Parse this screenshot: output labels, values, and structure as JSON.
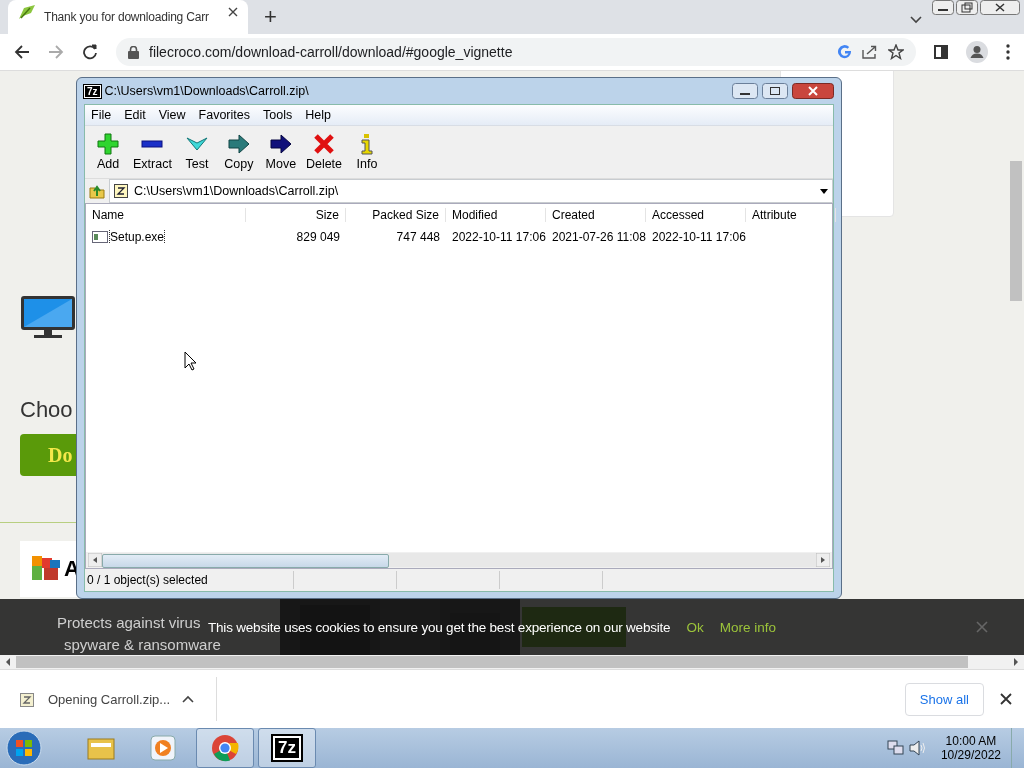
{
  "browser": {
    "tabs": [
      {
        "title": "Thank you for downloading Carr",
        "selected": true
      }
    ],
    "new_tab": "+",
    "url": "filecroco.com/download-carroll/download/#google_vignette"
  },
  "page": {
    "choose_text": "Choo",
    "download_button": "Do",
    "antivirus_name": "A",
    "antivirus_desc": "Protects against virus",
    "antivirus_desc2": "spyware & ransomware"
  },
  "archive_window": {
    "app_icon": "7z",
    "title": "C:\\Users\\vm1\\Downloads\\Carroll.zip\\",
    "menu": [
      "File",
      "Edit",
      "View",
      "Favorites",
      "Tools",
      "Help"
    ],
    "toolbar": [
      {
        "label": "Add",
        "kind": "add"
      },
      {
        "label": "Extract",
        "kind": "extract"
      },
      {
        "label": "Test",
        "kind": "test"
      },
      {
        "label": "Copy",
        "kind": "copy"
      },
      {
        "label": "Move",
        "kind": "move"
      },
      {
        "label": "Delete",
        "kind": "delete"
      },
      {
        "label": "Info",
        "kind": "info"
      }
    ],
    "path": "C:\\Users\\vm1\\Downloads\\Carroll.zip\\",
    "columns": [
      {
        "label": "Name"
      },
      {
        "label": "Size"
      },
      {
        "label": "Packed Size"
      },
      {
        "label": "Modified"
      },
      {
        "label": "Created"
      },
      {
        "label": "Accessed"
      },
      {
        "label": "Attribute"
      }
    ],
    "rows": [
      {
        "cells": [
          "Setup.exe",
          "829 049",
          "747 448",
          "2022-10-11 17:06",
          "2021-07-26 11:08",
          "2022-10-11 17:06"
        ],
        "focused": true
      }
    ],
    "status": [
      "0 / 1 object(s) selected"
    ]
  },
  "cookie_bar": {
    "message": "This website uses cookies to ensure you get the best experience on our website",
    "ok": "Ok",
    "more": "More info"
  },
  "download_bar": {
    "items": [
      {
        "name": "Opening Carroll.zip..."
      }
    ],
    "show_all": "Show all"
  },
  "taskbar": {
    "apps": [
      {
        "kind": "explorer",
        "active": false
      },
      {
        "kind": "media",
        "active": false
      },
      {
        "kind": "chrome",
        "active": true
      },
      {
        "kind": "sevenzip",
        "label": "7z",
        "active": true
      }
    ],
    "time": "10:00 AM",
    "date": "10/29/2022"
  }
}
